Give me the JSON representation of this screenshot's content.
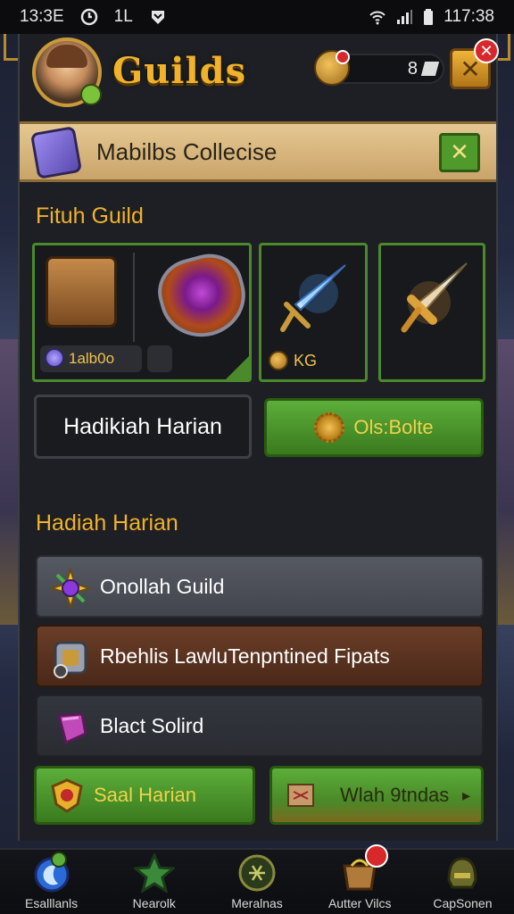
{
  "status_bar": {
    "time_left": "13:3E",
    "mid_text": "1L",
    "time_right": "117:38"
  },
  "header": {
    "title": "Guilds",
    "currency_value": "8"
  },
  "banner": {
    "text": "Mabilbs Collecise"
  },
  "section1": {
    "title": "Fituh Guild",
    "card1_value": "1alb0o",
    "card2_value": "KG"
  },
  "buttons": {
    "dark_label": "Hadikiah Harian",
    "green_label": "Ols:Bolte"
  },
  "section2": {
    "title": "Hadiah Harian",
    "rows": [
      {
        "label": "Onollah Guild",
        "icon": "compass-star-icon"
      },
      {
        "label": "Rbehlis LawluTenpntined Fipats",
        "icon": "armor-icon"
      },
      {
        "label": "Blact Solird",
        "icon": "pink-gem-icon"
      }
    ]
  },
  "bottom_buttons": {
    "left": "Saal Harian",
    "right": "Wlah 9tndas"
  },
  "nav": {
    "items": [
      {
        "label": "Esalllanls",
        "icon": "moon-orb-icon"
      },
      {
        "label": "Nearolk",
        "icon": "green-star-icon"
      },
      {
        "label": "Meralnas",
        "icon": "emblem-icon"
      },
      {
        "label": "Autter Vilcs",
        "icon": "shop-icon"
      },
      {
        "label": "CapSonen",
        "icon": "helmet-icon"
      }
    ]
  },
  "colors": {
    "accent_gold": "#f0b22a",
    "green": "#4f9a2a",
    "panel": "#1d1f24"
  }
}
